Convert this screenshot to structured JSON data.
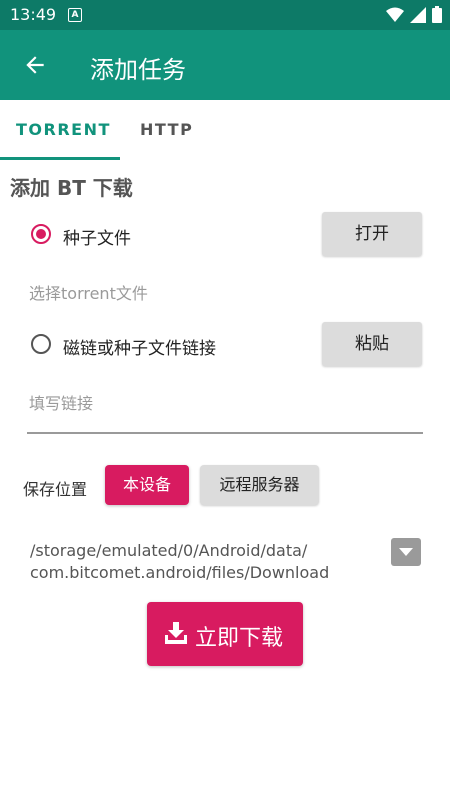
{
  "status_bar": {
    "time": "13:49",
    "notification_badge": "A",
    "icons": [
      "wifi-icon",
      "signal-icon",
      "battery-icon"
    ]
  },
  "app_bar": {
    "title": "添加任务",
    "back_icon": "arrow-left-icon"
  },
  "tabs": [
    {
      "label": "TORRENT",
      "active": true
    },
    {
      "label": "HTTP",
      "active": false
    }
  ],
  "bt_section": {
    "title": "添加 BT 下载",
    "torrent_option": {
      "label": "种子文件",
      "checked": true,
      "button": "打开",
      "hint": "选择torrent文件"
    },
    "magnet_option": {
      "label": "磁链或种子文件链接",
      "checked": false,
      "button": "粘贴",
      "input_placeholder": "填写链接"
    }
  },
  "save_location": {
    "label": "保存位置",
    "local_button": "本设备",
    "remote_button": "远程服务器",
    "path_line1": "/storage/emulated/0/Android/data/",
    "path_line2": "com.bitcomet.android/files/Download"
  },
  "download_button": {
    "label": "立即下载",
    "icon": "download-icon"
  },
  "colors": {
    "status_bar": "#0d7a67",
    "app_bar": "#11937c",
    "accent": "#d81b60",
    "secondary_button": "#dcdcdc"
  }
}
